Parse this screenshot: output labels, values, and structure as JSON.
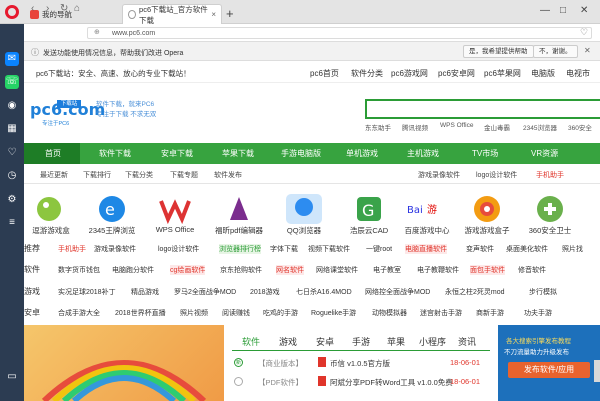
{
  "browser": {
    "tab1_title": "我的导航",
    "tab2_title": "pc6下载站_官方软件下载",
    "new_tab": "+",
    "url": "www.pc6.com",
    "info_text": "发送功能使用情况信息，帮助我们改进 Opera",
    "info_yes": "是，我希望提供帮助",
    "info_no": "不，谢谢。"
  },
  "site": {
    "top_left": "pc6下载站：安全、高速、放心的专业下载站！",
    "top_links": [
      "pc6首页",
      "软件分类",
      "pc6游戏网",
      "pc6安卓网",
      "pc6苹果网",
      "电脑版",
      "电视市"
    ],
    "logo_text": "pc6.com",
    "logo_badge": "下载站",
    "logo_sub": "专注于PC6",
    "slogan_line1": "软件下载，就来PC6",
    "slogan_line2": "专注于下载 不求无双",
    "quick_links": [
      "东东助手",
      "腾讯视频",
      "WPS Office",
      "金山毒霸",
      "2345浏览器",
      "360安全"
    ],
    "main_nav": [
      "首页",
      "软件下载",
      "安卓下载",
      "苹果下载",
      "手游电脑版",
      "单机游戏",
      "主机游戏",
      "TV市场",
      "VR资源"
    ],
    "sub_nav": [
      "最近更新",
      "下载排行",
      "下载分类",
      "下载专题",
      "软件发布"
    ],
    "sub_nav_right": [
      "游戏录像软件",
      "logo设计软件",
      "手机助手"
    ],
    "icons": [
      "逗游游戏盒",
      "2345王牌浏览",
      "WPS Office",
      "福昕pdf编辑器",
      "QQ浏览器",
      "浩辰云CAD",
      "百度游戏中心",
      "游戏游戏盒子",
      "360安全卫士"
    ],
    "rows": [
      {
        "head": "推荐",
        "items": [
          "手机助手",
          "游戏录像软件",
          "logo设计软件",
          "浏览器排行榜",
          "字体下载",
          "视频下载软件",
          "一键root",
          "电脑直播软件",
          "变声软件",
          "桌面美化软件",
          "照片找"
        ]
      },
      {
        "head": "软件",
        "items": [
          "数字货币钱包",
          "电脑跑分软件",
          "cg绘画软件",
          "京东抢购软件",
          "网名软件",
          "网络课堂软件",
          "电子教室",
          "电子教鞭软件",
          "面包手软件",
          "修音软件"
        ]
      },
      {
        "head": "游戏",
        "items": [
          "实况足球2018补丁",
          "精品游戏",
          "罗马2全面战争MOD",
          "2018游戏",
          "七日杀A16.4MOD",
          "网络控全面战争MOD",
          "永恒之柱2死灵mod",
          "步行模拟"
        ]
      },
      {
        "head": "安卓",
        "items": [
          "合成手游大全",
          "2018世界杯直播",
          "照片视频",
          "阅读赚钱",
          "吃鸡的手游",
          "Roguelike手游",
          "动物模拟器",
          "迷宫射击手游",
          "商新手游",
          "功夫手游"
        ]
      }
    ],
    "news_tabs": [
      "软件",
      "游戏",
      "安卓",
      "手游",
      "苹果",
      "小程序",
      "资讯"
    ],
    "news": [
      {
        "tag": "【商业版本】",
        "title": "币信 v1.0.5官方版",
        "date": "18-06-01"
      },
      {
        "tag": "【PDF软件】",
        "title": "阿斌分享PDF转Word工具 v1.0.0免费",
        "date": "18-06-01"
      }
    ],
    "ad_text1": "各大搜索引擎发布教程",
    "ad_text2": "不刀流量助力升级发布",
    "publish_btn": "发布软件/应用"
  }
}
